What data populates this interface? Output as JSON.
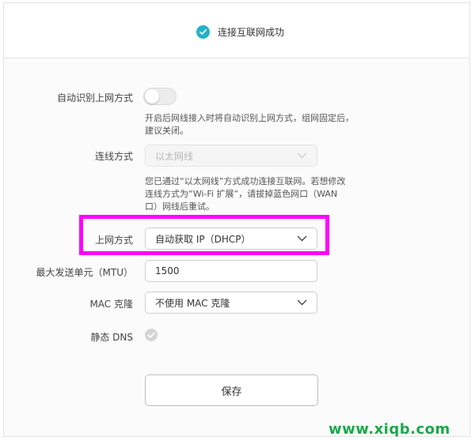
{
  "status": {
    "text": "连接互联网成功",
    "icon": "check-circle-icon"
  },
  "auto_detect": {
    "label": "自动识别上网方式",
    "enabled": false,
    "hint_line1": "开启后网线接入时将自动识别上网方式，组网固定后，",
    "hint_line2": "建议关闭。"
  },
  "connection_type": {
    "label": "连线方式",
    "value": "以太网线",
    "hint_line1": "您已通过“以太网线”方式成功连接互联网。若想修改",
    "hint_line2": "连线方式为“Wi-Fi 扩展”，请拔掉蓝色网口（WAN",
    "hint_line3": "口）网线后重试。"
  },
  "internet_mode": {
    "label": "上网方式",
    "value": "自动获取 IP（DHCP）"
  },
  "mtu": {
    "label": "最大发送单元（MTU）",
    "value": "1500"
  },
  "mac_clone": {
    "label": "MAC 克隆",
    "value": "不使用 MAC 克隆"
  },
  "static_dns": {
    "label": "静态 DNS",
    "checked": false
  },
  "save_button": {
    "label": "保存"
  },
  "watermark": {
    "text": "www.xiqb.com"
  },
  "colors": {
    "accent": "#22b3c6",
    "highlight": "#ff00ff",
    "watermark": "#1aa84a"
  }
}
